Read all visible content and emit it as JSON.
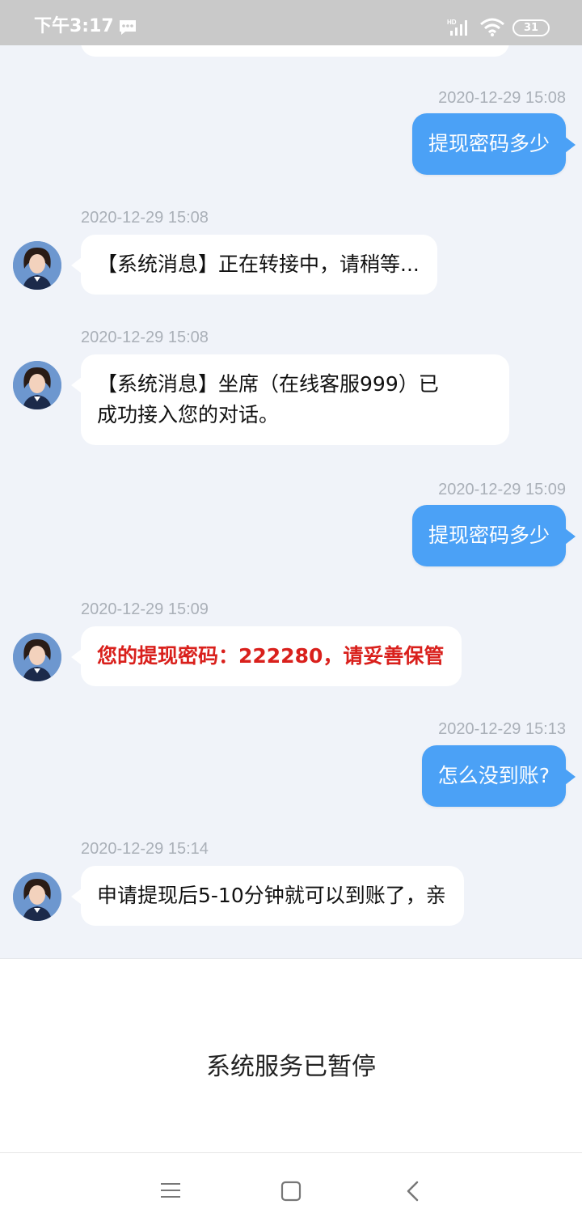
{
  "status_bar": {
    "time": "下午3:17",
    "network_label": "HD",
    "battery_level": "31",
    "icons": [
      "message-icon",
      "signal-icon",
      "wifi-icon",
      "battery-icon"
    ]
  },
  "messages": [
    {
      "side": "out",
      "timestamp": "2020-12-29 15:08",
      "text": "提现密码多少"
    },
    {
      "side": "in",
      "timestamp": "2020-12-29 15:08",
      "text": "【系统消息】正在转接中，请稍等..."
    },
    {
      "side": "in",
      "timestamp": "2020-12-29 15:08",
      "text_line1": "【系统消息】坐席（在线客服999）已",
      "text_line2": "成功接入您的对话。"
    },
    {
      "side": "out",
      "timestamp": "2020-12-29 15:09",
      "text": "提现密码多少"
    },
    {
      "side": "in",
      "timestamp": "2020-12-29 15:09",
      "text": "您的提现密码：222280，请妥善保管",
      "highlight_color": "#d9201c"
    },
    {
      "side": "out",
      "timestamp": "2020-12-29 15:13",
      "text": "怎么没到账?"
    },
    {
      "side": "in",
      "timestamp": "2020-12-29 15:14",
      "text": "申请提现后5-10分钟就可以到账了，亲"
    }
  ],
  "footer": {
    "notice": "系统服务已暂停"
  },
  "nav": {
    "buttons": [
      "menu-icon",
      "home-icon",
      "back-icon"
    ]
  },
  "colors": {
    "outgoing_bubble": "#4ba1f6",
    "incoming_bubble": "#ffffff",
    "chat_background": "#f0f3f9",
    "alert_text": "#d9201c"
  }
}
